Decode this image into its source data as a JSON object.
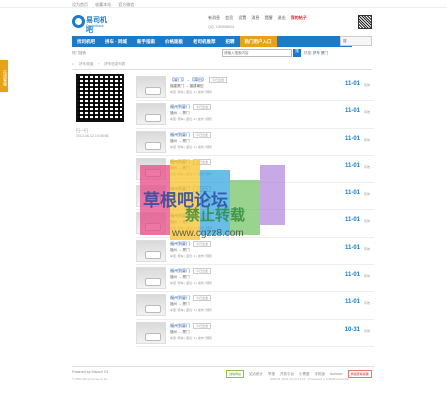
{
  "topbar": {
    "links": [
      "设为首页",
      "收藏本站",
      "官方微信"
    ]
  },
  "logo": {
    "title": "易司机吧",
    "subtitle": "Dacheboss"
  },
  "userbar": {
    "items": [
      "有消息",
      "会员",
      "设置",
      "消息",
      "提醒",
      "退出"
    ],
    "highlight": "我的帖子",
    "qq": "QQ: 1183958001"
  },
  "nav": {
    "items": [
      "找司机吧",
      "拼车 · 同城",
      "新手指南",
      "价格面板",
      "老司机推荐",
      "招聘",
      "热门用户入口"
    ],
    "active_index": 0
  },
  "search": {
    "placeholder": "请输入搜索内容",
    "button": "搜",
    "hot_label": "热搜:",
    "hot_terms": [
      "拼车",
      "厦门"
    ]
  },
  "subnav": {
    "hot_label": "热门搜索"
  },
  "breadcrumb": [
    "拼车频道",
    "拼车信息列表"
  ],
  "side_tab": {
    "label": "在线客服"
  },
  "qr": {
    "caption": "扫一扫",
    "date": "2013-08-12 15:08:56"
  },
  "listings": [
    {
      "title": "【厦门】→【莆田】",
      "tag": "今日出发",
      "route": "福建厦门 → 福建莆田",
      "meta": "车型: 轿车 | 座位: 4 | 发布: 刚刚",
      "date": "11-01",
      "flag": "有效"
    },
    {
      "title": "福州到厦门",
      "tag": "今日出发",
      "route": "福州 → 厦门",
      "meta": "车型: 轿车 | 座位: 4 | 发布: 刚刚",
      "date": "11-01",
      "flag": "有效"
    },
    {
      "title": "福州到厦门",
      "tag": "今日出发",
      "route": "福州 → 厦门",
      "meta": "车型: 轿车 | 座位: 4 | 发布: 刚刚",
      "date": "11-01",
      "flag": "有效"
    },
    {
      "title": "福州到厦门",
      "tag": "今日出发",
      "route": "福州 → 厦门",
      "meta": "车型: 轿车 | 座位: 4 | 发布: 刚刚",
      "date": "11-01",
      "flag": "有效"
    },
    {
      "title": "福州到厦门",
      "tag": "今日出发",
      "route": "福州 → 厦门",
      "meta": "车型: 轿车 | 座位: 4 | 发布: 刚刚",
      "date": "11-01",
      "flag": "有效"
    },
    {
      "title": "福州到厦门",
      "tag": "今日出发",
      "route": "福州 → 厦门",
      "meta": "车型: 轿车 | 座位: 4 | 发布: 刚刚",
      "date": "11-01",
      "flag": "有效"
    },
    {
      "title": "福州到厦门",
      "tag": "今日出发",
      "route": "福州 → 厦门",
      "meta": "车型: 轿车 | 座位: 4 | 发布: 刚刚",
      "date": "11-01",
      "flag": "有效"
    },
    {
      "title": "福州到厦门",
      "tag": "今日出发",
      "route": "福州 → 厦门",
      "meta": "车型: 轿车 | 座位: 4 | 发布: 刚刚",
      "date": "11-01",
      "flag": "有效"
    },
    {
      "title": "福州到厦门",
      "tag": "今日出发",
      "route": "福州 → 厦门",
      "meta": "车型: 轿车 | 座位: 4 | 发布: 刚刚",
      "date": "11-01",
      "flag": "有效"
    },
    {
      "title": "福州到厦门",
      "tag": "今日出发",
      "route": "福州 → 厦门",
      "meta": "车型: 轿车 | 座位: 4 | 发布: 刚刚",
      "date": "10-31",
      "flag": "有效"
    }
  ],
  "footer": {
    "powered": "Powered by Discuz! X3",
    "copyright": "© 2001-2013 Comsenz Inc.",
    "links": [
      "站点统计",
      "举报",
      "开放平台",
      "小黑屋",
      "手机版",
      "Archiver"
    ],
    "badge_green": "诚信网站",
    "badge_red": "网络警察提醒",
    "stats": "GMT+8, 2024-10-31 10:21 , Processed in 0.0839 second(s)"
  },
  "watermark": {
    "line1": "草根吧论坛",
    "line2": "禁止转载",
    "line3": "www.cgzz8.com"
  },
  "colors": {
    "brand_blue": "#1a7cc9",
    "accent_orange": "#e8a21a"
  }
}
